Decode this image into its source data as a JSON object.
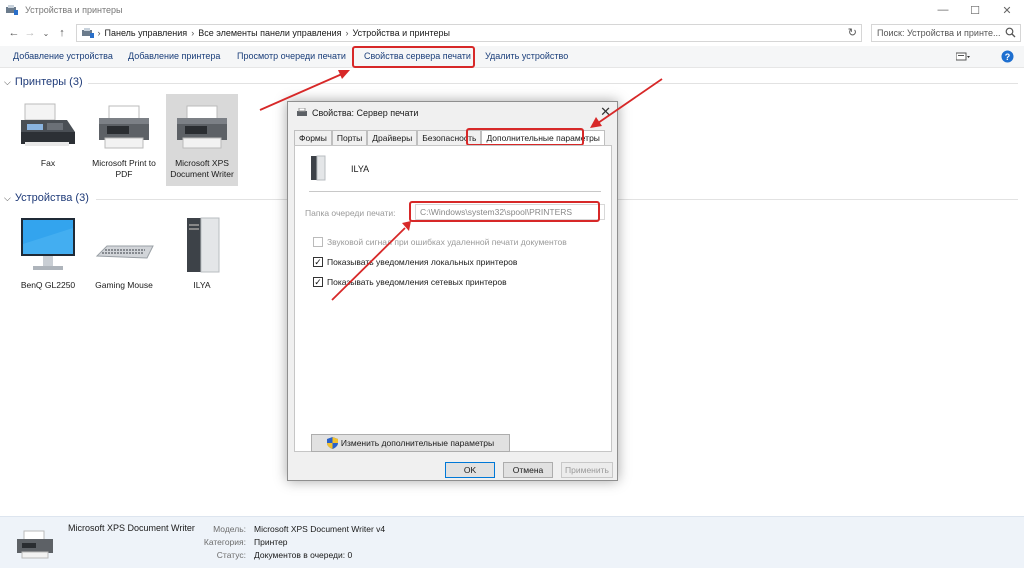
{
  "window": {
    "title": "Устройства и принтеры"
  },
  "address": {
    "crumbs": [
      "Панель управления",
      "Все элементы панели управления",
      "Устройства и принтеры"
    ],
    "search_placeholder": "Поиск: Устройства и принте..."
  },
  "commands": [
    "Добавление устройства",
    "Добавление принтера",
    "Просмотр очереди печати",
    "Свойства сервера печати",
    "Удалить устройство"
  ],
  "groups": {
    "printers": {
      "header": "Принтеры (3)",
      "items": [
        {
          "label": "Fax",
          "icon": "fax-icon"
        },
        {
          "label": "Microsoft Print to PDF",
          "icon": "printer-icon"
        },
        {
          "label": "Microsoft XPS Document Writer",
          "icon": "printer-icon"
        }
      ]
    },
    "devices": {
      "header": "Устройства (3)",
      "items": [
        {
          "label": "BenQ GL2250",
          "icon": "monitor-icon"
        },
        {
          "label": "Gaming Mouse",
          "icon": "keyboard-icon"
        },
        {
          "label": "ILYA",
          "icon": "computer-tower-icon"
        }
      ]
    }
  },
  "dialog": {
    "title": "Свойства: Сервер печати",
    "tabs": [
      "Формы",
      "Порты",
      "Драйверы",
      "Безопасность",
      "Дополнительные параметры"
    ],
    "server_name": "ILYA",
    "spool_label": "Папка очереди печати:",
    "spool_path": "C:\\Windows\\system32\\spool\\PRINTERS",
    "checks": [
      {
        "label": "Звуковой сигнал при ошибках удаленной печати документов",
        "checked": false,
        "enabled": false
      },
      {
        "label": "Показывать уведомления локальных принтеров",
        "checked": true,
        "enabled": true
      },
      {
        "label": "Показывать уведомления сетевых принтеров",
        "checked": true,
        "enabled": true
      }
    ],
    "change_button": "Изменить дополнительные параметры",
    "ok": "OK",
    "cancel": "Отмена",
    "apply": "Применить"
  },
  "details": {
    "name": "Microsoft XPS Document Writer",
    "model_label": "Модель:",
    "model_value": "Microsoft XPS Document Writer v4",
    "category_label": "Категория:",
    "category_value": "Принтер",
    "status_label": "Статус:",
    "status_value": "Документов в очереди: 0"
  },
  "colors": {
    "annotation": "#d72828",
    "link": "#1a3e7a",
    "group_header": "#1e3a78"
  }
}
